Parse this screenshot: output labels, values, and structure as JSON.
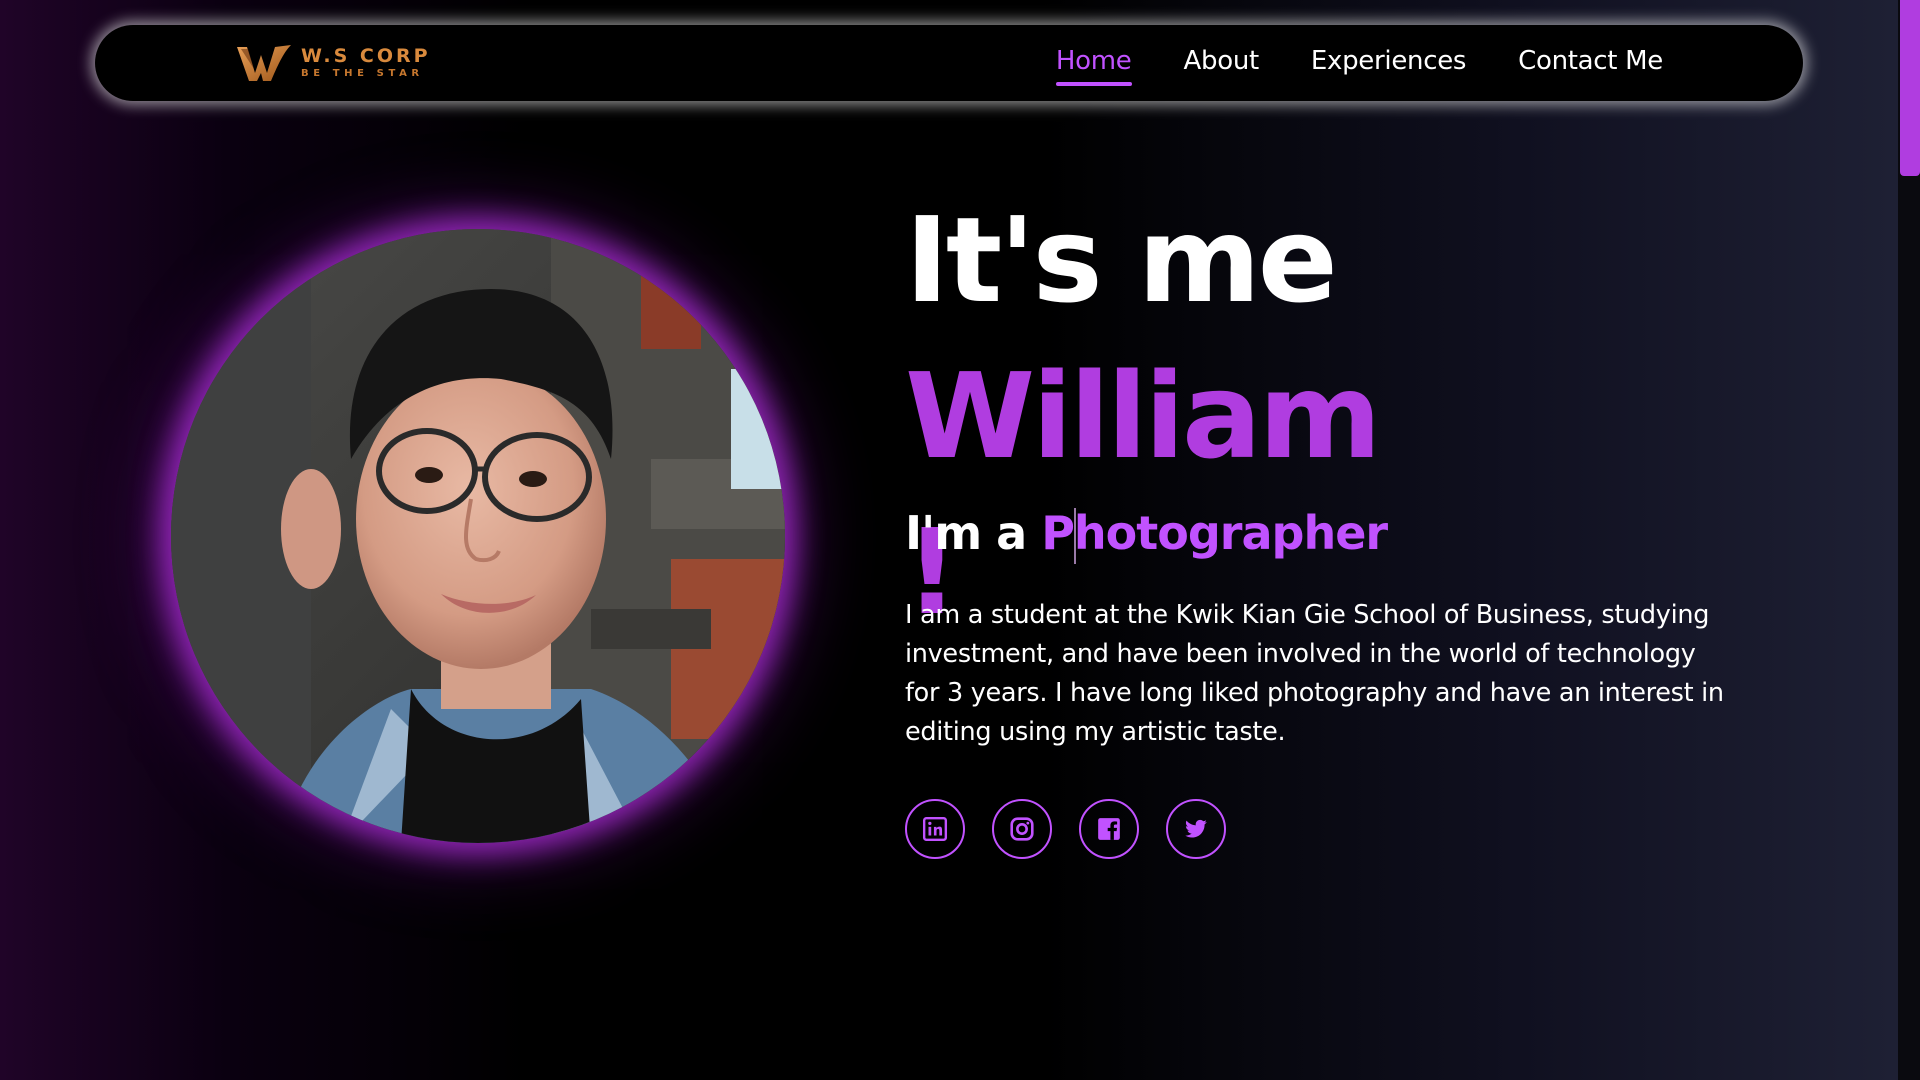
{
  "nav": {
    "logo_name": "W.S CORP",
    "logo_tagline": "BE THE STAR",
    "links": [
      {
        "label": "Home",
        "active": true
      },
      {
        "label": "About",
        "active": false
      },
      {
        "label": "Experiences",
        "active": false
      },
      {
        "label": "Contact Me",
        "active": false
      }
    ]
  },
  "hero": {
    "title_prefix": "It's me",
    "title_name": "William",
    "title_suffix": "!",
    "subtitle_prefix": "I'm a",
    "subtitle_role": "Photographer",
    "bio": "I am a student at the Kwik Kian Gie School of Business, studying investment, and have been involved in the world of technology for 3 years. I have long liked photography and have an interest in editing using my artistic taste."
  },
  "socials": [
    {
      "icon": "linkedin-icon"
    },
    {
      "icon": "instagram-icon"
    },
    {
      "icon": "facebook-icon"
    },
    {
      "icon": "twitter-icon"
    }
  ],
  "colors": {
    "accent": "#b03de0",
    "accent_light": "#c152ff",
    "logo": "#d98a3d",
    "background": "#000000"
  }
}
